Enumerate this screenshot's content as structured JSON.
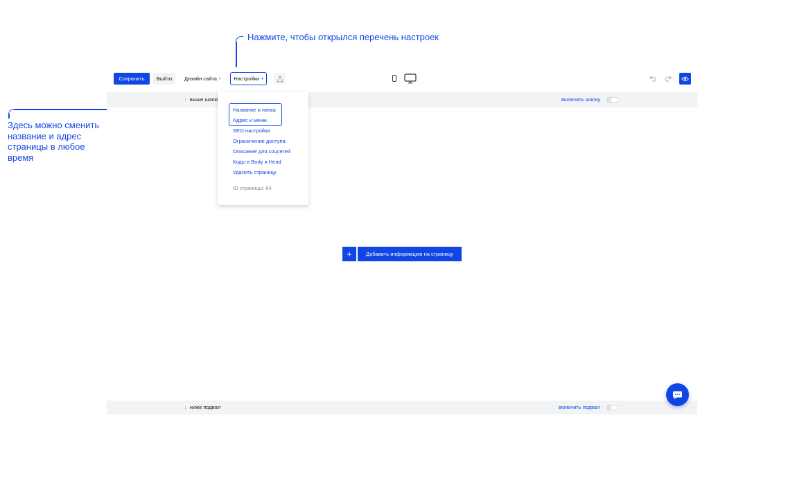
{
  "annotations": {
    "top": "Нажмите, чтобы открылся перечень настроек",
    "left": "Здесь можно сменить название и адрес страницы в любое время"
  },
  "toolbar": {
    "save_label": "Сохранить",
    "exit_label": "Выйти",
    "design_label": "Дизайн сайта",
    "settings_label": "Настройки"
  },
  "header": {
    "above_label": "выше шапки",
    "toggle_label": "включить шапку"
  },
  "footer": {
    "below_label": "ниже подвал",
    "toggle_label": "включить подвал"
  },
  "settings_menu": {
    "items": [
      "Название и папка",
      "Адрес и меню",
      "SEO настройки",
      "Ограничение доступа",
      "Описание для соцсетей",
      "Коды в Body и Head",
      "Удалить страницу"
    ],
    "page_id": "ID страницы: 64"
  },
  "content": {
    "add_label": "Добавить информацию на страницу",
    "add_plus": "+"
  },
  "colors": {
    "accent": "#1146e6",
    "bar_bg": "#f2f3f5"
  },
  "icons": [
    "share-icon",
    "phone-icon",
    "desktop-icon",
    "undo-icon",
    "redo-icon",
    "eye-icon",
    "chat-icon",
    "arrow-up-icon",
    "arrow-down-icon"
  ]
}
